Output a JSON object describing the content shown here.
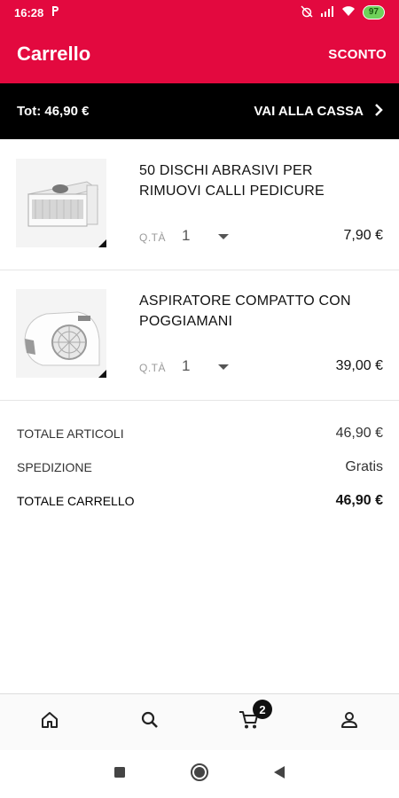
{
  "status_bar": {
    "time": "16:28",
    "carrier_icon": "p-icon",
    "battery": "97"
  },
  "appbar": {
    "title": "Carrello",
    "discount_label": "SCONTO"
  },
  "totals_bar": {
    "total": "Tot: 46,90 €",
    "checkout_label": "VAI ALLA CASSA"
  },
  "cart": {
    "items": [
      {
        "name": "50 DISCHI ABRASIVI PER RIMUOVI CALLI PEDICURE",
        "qty_label": "Q.TÀ",
        "qty": "1",
        "price": "7,90 €"
      },
      {
        "name": "ASPIRATORE COMPATTO CON POGGIAMANI",
        "qty_label": "Q.TÀ",
        "qty": "1",
        "price": "39,00 €"
      }
    ]
  },
  "summary": {
    "articles_label": "TOTALE ARTICOLI",
    "articles_value": "46,90 €",
    "shipping_label": "SPEDIZIONE",
    "shipping_value": "Gratis",
    "cart_total_label": "TOTALE CARRELLO",
    "cart_total_value": "46,90 €"
  },
  "bottom_nav": {
    "cart_badge": "2",
    "tabs": [
      "home-icon",
      "search-icon",
      "cart-icon",
      "account-icon"
    ]
  },
  "colors": {
    "brand": "#e3093f",
    "bar": "#000000"
  }
}
